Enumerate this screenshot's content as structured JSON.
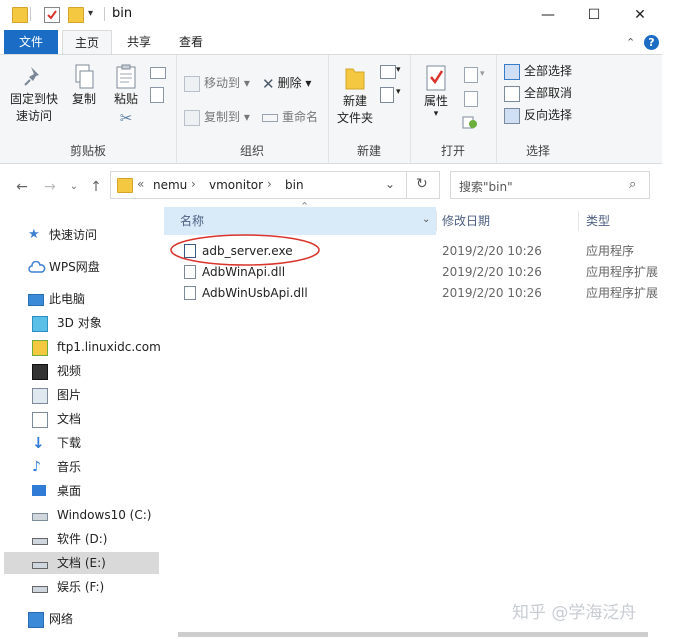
{
  "window": {
    "title": "bin",
    "controls": {
      "minimize": "—",
      "maximize": "☐",
      "close": "✕"
    }
  },
  "ribbon_tabs": [
    {
      "label": "文件"
    },
    {
      "label": "主页"
    },
    {
      "label": "共享"
    },
    {
      "label": "查看"
    }
  ],
  "ribbon": {
    "clipboard": {
      "group_label": "剪贴板",
      "pin_label_1": "固定到快",
      "pin_label_2": "速访问",
      "copy_label": "复制",
      "paste_label": "粘贴"
    },
    "organize": {
      "group_label": "组织",
      "move_to": "移动到",
      "copy_to": "复制到",
      "delete": "删除",
      "rename": "重命名"
    },
    "new": {
      "group_label": "新建",
      "new_folder_1": "新建",
      "new_folder_2": "文件夹"
    },
    "open": {
      "group_label": "打开",
      "properties": "属性"
    },
    "select": {
      "group_label": "选择",
      "select_all": "全部选择",
      "select_none": "全部取消",
      "invert": "反向选择"
    }
  },
  "address": {
    "path": [
      "nemu",
      "vmonitor",
      "bin"
    ],
    "search_placeholder": "搜索\"bin\""
  },
  "sidebar": {
    "items": [
      {
        "label": "快速访问",
        "icon": "star-icon"
      },
      {
        "label": "WPS网盘",
        "icon": "cloud-icon"
      },
      {
        "label": "此电脑",
        "icon": "computer-icon"
      },
      {
        "label": "3D 对象",
        "icon": "cube-icon"
      },
      {
        "label": "ftp1.linuxidc.com",
        "icon": "network-folder-icon"
      },
      {
        "label": "视频",
        "icon": "video-icon"
      },
      {
        "label": "图片",
        "icon": "pictures-icon"
      },
      {
        "label": "文档",
        "icon": "documents-icon"
      },
      {
        "label": "下载",
        "icon": "download-icon"
      },
      {
        "label": "音乐",
        "icon": "music-icon"
      },
      {
        "label": "桌面",
        "icon": "desktop-icon"
      },
      {
        "label": "Windows10 (C:)",
        "icon": "drive-icon"
      },
      {
        "label": "软件 (D:)",
        "icon": "drive-icon"
      },
      {
        "label": "文档 (E:)",
        "icon": "drive-icon"
      },
      {
        "label": "娱乐 (F:)",
        "icon": "drive-icon"
      },
      {
        "label": "网络",
        "icon": "network-icon"
      }
    ]
  },
  "file_list": {
    "columns": {
      "name": "名称",
      "date": "修改日期",
      "type": "类型"
    },
    "rows": [
      {
        "name": "adb_server.exe",
        "date": "2019/2/20 10:26",
        "type": "应用程序"
      },
      {
        "name": "AdbWinApi.dll",
        "date": "2019/2/20 10:26",
        "type": "应用程序扩展"
      },
      {
        "name": "AdbWinUsbApi.dll",
        "date": "2019/2/20 10:26",
        "type": "应用程序扩展"
      }
    ]
  },
  "watermark": "知乎 @学海泛舟",
  "colors": {
    "accent": "#1a6cc4",
    "highlight_circle": "#d9332b",
    "selected": "#d9d9d9"
  }
}
